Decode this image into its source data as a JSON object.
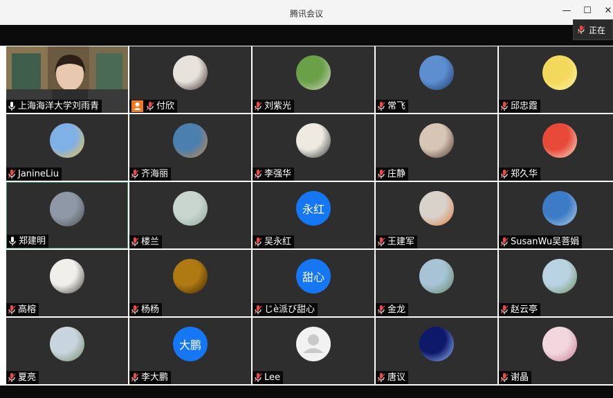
{
  "window": {
    "title": "腾讯会议"
  },
  "toast": {
    "text": "正在"
  },
  "participants": [
    {
      "name": "上海海洋大学刘雨青",
      "mic": "on",
      "kind": "video"
    },
    {
      "name": "付欣",
      "mic": "muted",
      "kind": "photo",
      "host": true,
      "colors": [
        "#e8e2dd",
        "#3a2b25"
      ]
    },
    {
      "name": "刘紫光",
      "mic": "muted",
      "kind": "photo",
      "colors": [
        "#6aa048",
        "#d8d8c8"
      ]
    },
    {
      "name": "常飞",
      "mic": "muted",
      "kind": "photo",
      "colors": [
        "#5d8fd0",
        "#1b3b68"
      ]
    },
    {
      "name": "邱忠霞",
      "mic": "muted",
      "kind": "photo",
      "colors": [
        "#f3d95b",
        "#fff3a8"
      ]
    },
    {
      "name": "JanineLiu",
      "mic": "muted",
      "kind": "photo",
      "colors": [
        "#7fb0e6",
        "#f4c542"
      ]
    },
    {
      "name": "齐海丽",
      "mic": "muted",
      "kind": "photo",
      "colors": [
        "#4b7fae",
        "#c88a4a"
      ]
    },
    {
      "name": "李强华",
      "mic": "muted",
      "kind": "photo",
      "colors": [
        "#eeeae2",
        "#2c2c2c"
      ]
    },
    {
      "name": "庄静",
      "mic": "muted",
      "kind": "photo",
      "colors": [
        "#d7c5b5",
        "#4b3427"
      ]
    },
    {
      "name": "郑久华",
      "mic": "muted",
      "kind": "photo",
      "colors": [
        "#e84a3a",
        "#f6e6d0"
      ]
    },
    {
      "name": "郑建明",
      "mic": "on",
      "kind": "photo",
      "active": true,
      "colors": [
        "#8e98a6",
        "#4a4f57"
      ]
    },
    {
      "name": "楼兰",
      "mic": "muted",
      "kind": "photo",
      "colors": [
        "#c9d6cf",
        "#8da89a"
      ]
    },
    {
      "name": "吴永红",
      "mic": "muted",
      "kind": "text",
      "avatar_text": "永红"
    },
    {
      "name": "王建军",
      "mic": "muted",
      "kind": "photo",
      "colors": [
        "#d8d2cb",
        "#e07b3a"
      ]
    },
    {
      "name": "SusanWu吴菩娟",
      "mic": "muted",
      "kind": "photo",
      "colors": [
        "#3d7bc6",
        "#b7d3ea"
      ]
    },
    {
      "name": "高榕",
      "mic": "muted",
      "kind": "photo",
      "colors": [
        "#f1efe9",
        "#3b3b3b"
      ]
    },
    {
      "name": "杨杨",
      "mic": "muted",
      "kind": "photo",
      "colors": [
        "#b07a12",
        "#3b2605"
      ]
    },
    {
      "name": "じè派び甜心",
      "mic": "muted",
      "kind": "text",
      "avatar_text": "甜心"
    },
    {
      "name": "金龙",
      "mic": "muted",
      "kind": "photo",
      "colors": [
        "#a8c3d6",
        "#5a8760"
      ]
    },
    {
      "name": "赵云亭",
      "mic": "muted",
      "kind": "photo",
      "colors": [
        "#b9d3e3",
        "#6c8e5c"
      ]
    },
    {
      "name": "夏亮",
      "mic": "muted",
      "kind": "photo",
      "colors": [
        "#c8d5de",
        "#6d8a63"
      ]
    },
    {
      "name": "李大鹏",
      "mic": "muted",
      "kind": "text",
      "avatar_text": "大鹏"
    },
    {
      "name": "Lee",
      "mic": "muted",
      "kind": "default"
    },
    {
      "name": "唐议",
      "mic": "muted",
      "kind": "photo",
      "colors": [
        "#0d1a6a",
        "#9ec0ff"
      ]
    },
    {
      "name": "谢晶",
      "mic": "muted",
      "kind": "photo",
      "colors": [
        "#f2d7de",
        "#c47b94"
      ]
    }
  ],
  "colors": {
    "tile_bg": "#2e2e2e",
    "avatar_blue": "#1677f5",
    "active_border": "#2e9a4e",
    "host_badge": "#f07b22",
    "mic_muted": "#f04848"
  }
}
